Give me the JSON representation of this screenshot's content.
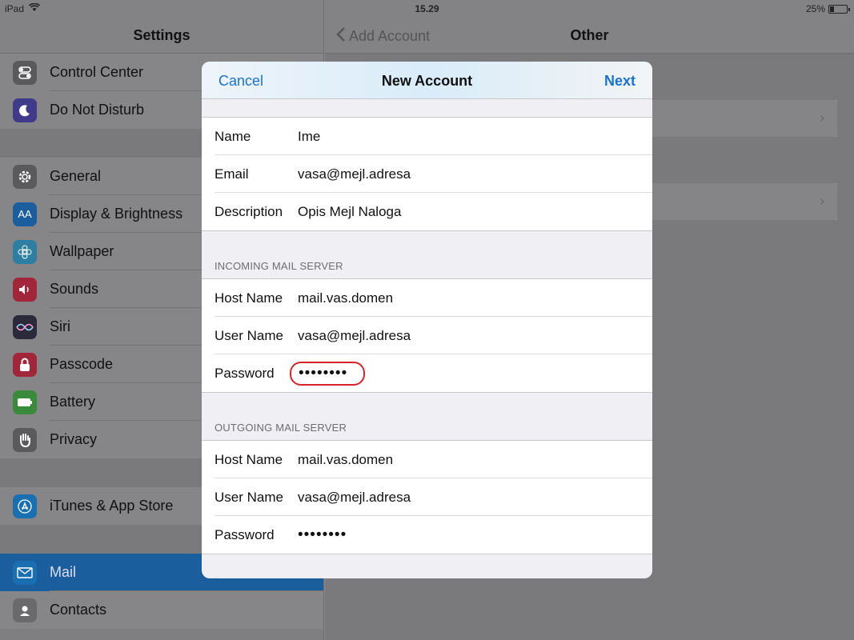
{
  "status": {
    "device": "iPad",
    "time": "15.29",
    "battery": "25%",
    "battery_level": 0.25
  },
  "sidebar": {
    "title": "Settings",
    "groups": [
      [
        {
          "label": "Control Center",
          "icon": "control-center-icon",
          "color": "#5a5a5c"
        },
        {
          "label": "Do Not Disturb",
          "icon": "moon-icon",
          "color": "#3f3a8a"
        }
      ],
      [
        {
          "label": "General",
          "icon": "gear-icon",
          "color": "#5a5a5c"
        },
        {
          "label": "Display & Brightness",
          "icon": "display-icon",
          "color": "#1a5e9e"
        },
        {
          "label": "Wallpaper",
          "icon": "flower-icon",
          "color": "#2c7fa0"
        },
        {
          "label": "Sounds",
          "icon": "speaker-icon",
          "color": "#a1263a"
        },
        {
          "label": "Siri",
          "icon": "siri-icon",
          "color": "#2a2a3a"
        },
        {
          "label": "Passcode",
          "icon": "lock-icon",
          "color": "#a1263a"
        },
        {
          "label": "Battery",
          "icon": "battery-icon",
          "color": "#3a8a3c"
        },
        {
          "label": "Privacy",
          "icon": "hand-icon",
          "color": "#5a5a5c"
        }
      ],
      [
        {
          "label": "iTunes & App Store",
          "icon": "app-store-icon",
          "color": "#1a6fb0"
        }
      ],
      [
        {
          "label": "Mail",
          "icon": "mail-icon",
          "color": "#1a6fb0",
          "selected": true
        },
        {
          "label": "Contacts",
          "icon": "contacts-icon",
          "color": "#6a6a6c"
        }
      ]
    ]
  },
  "detail": {
    "back_label": "Add Account",
    "title": "Other"
  },
  "modal": {
    "cancel_label": "Cancel",
    "title": "New Account",
    "next_label": "Next",
    "account": [
      {
        "label": "Name",
        "value": "Ime"
      },
      {
        "label": "Email",
        "value": "vasa@mejl.adresa"
      },
      {
        "label": "Description",
        "value": "Opis Mejl Naloga"
      }
    ],
    "incoming_header": "INCOMING MAIL SERVER",
    "incoming": [
      {
        "label": "Host Name",
        "value": "mail.vas.domen"
      },
      {
        "label": "User Name",
        "value": "vasa@mejl.adresa"
      },
      {
        "label": "Password",
        "value": "••••••••",
        "password": true,
        "highlighted": true
      }
    ],
    "outgoing_header": "OUTGOING MAIL SERVER",
    "outgoing": [
      {
        "label": "Host Name",
        "value": "mail.vas.domen"
      },
      {
        "label": "User Name",
        "value": "vasa@mejl.adresa"
      },
      {
        "label": "Password",
        "value": "••••••••",
        "password": true
      }
    ]
  }
}
